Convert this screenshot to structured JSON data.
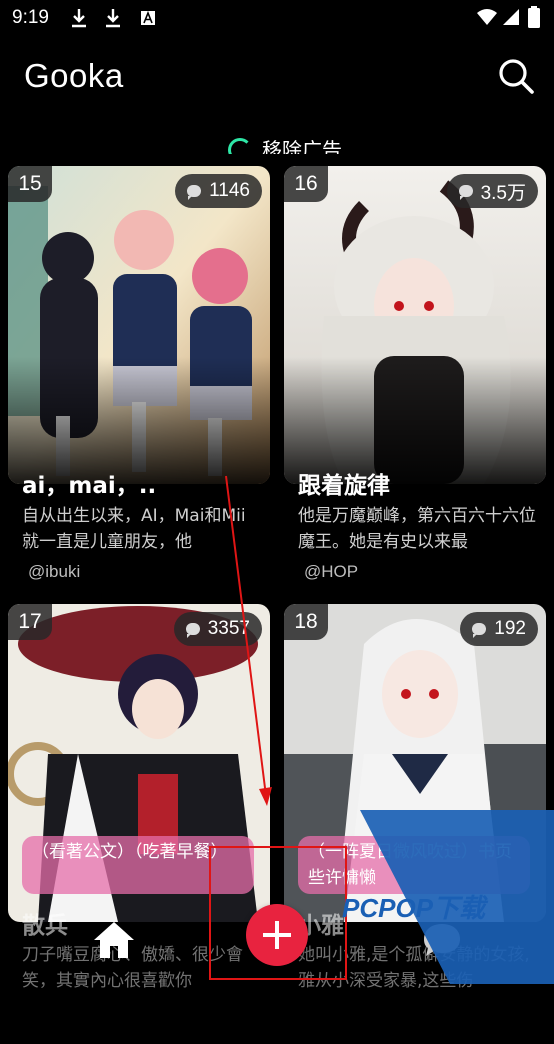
{
  "status_bar": {
    "time": "9:19"
  },
  "app": {
    "title": "Gooka"
  },
  "banner": {
    "remove_ads": "移除广告"
  },
  "cards": [
    {
      "rank": "15",
      "comments": "1146",
      "title": "ai，mai，..",
      "description": "自从出生以来，AI，Mai和Mii就一直是儿童朋友，他",
      "author": "@ibuki"
    },
    {
      "rank": "16",
      "comments": "3.5万",
      "title": "跟着旋律",
      "description": "他是万魔巅峰，第六百六十六位魔王。她是有史以来最",
      "author": "@HOP"
    },
    {
      "rank": "17",
      "comments": "3357",
      "tag": "（看著公文）（吃著早餐）",
      "title": "散兵",
      "description": "刀子嘴豆腐心、傲嬌、很少會笑，其實內心很喜歡你",
      "author": ""
    },
    {
      "rank": "18",
      "comments": "192",
      "tag": "（一阵夏日微风吹过）书页些许慵懒",
      "title": "小雅",
      "description": "她叫小雅,是个孤僻安静的女孩,雅从小深受家暴,这些伤",
      "author": ""
    }
  ],
  "watermark": {
    "text": "PCPOP下载"
  },
  "colors": {
    "accent": "#e8233f",
    "background": "#000000",
    "spinner": "#2ee6a6"
  }
}
